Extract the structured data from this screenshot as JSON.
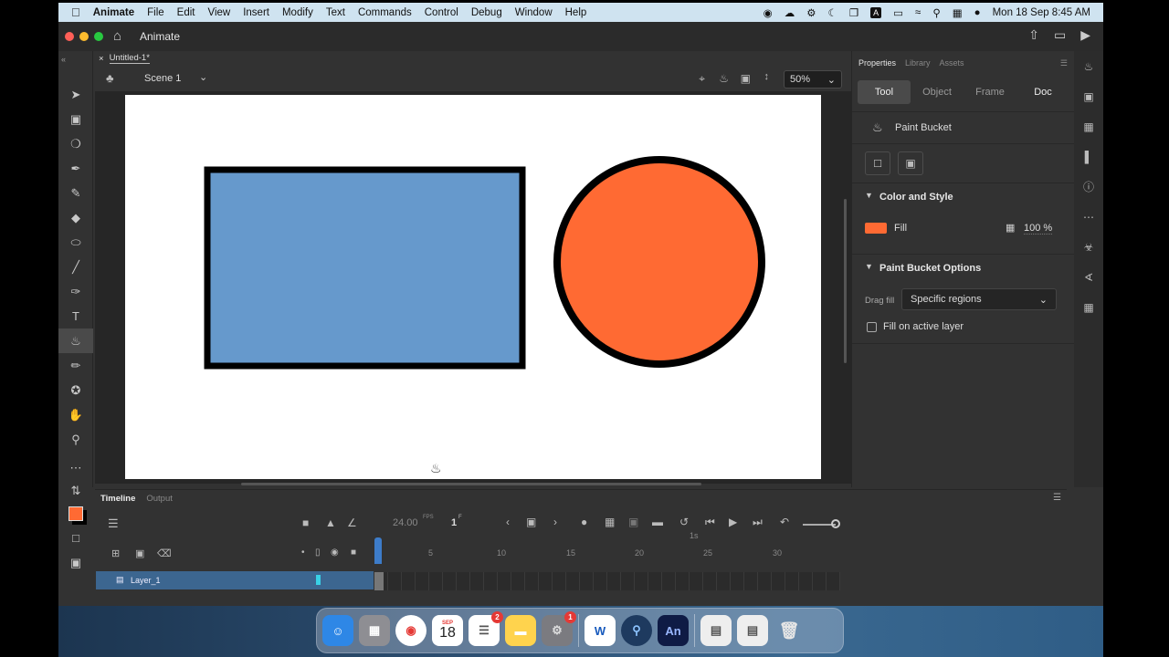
{
  "menubar": {
    "app": "Animate",
    "items": [
      "File",
      "Edit",
      "View",
      "Insert",
      "Modify",
      "Text",
      "Commands",
      "Control",
      "Debug",
      "Window",
      "Help"
    ],
    "clock": "Mon 18 Sep  8:45 AM",
    "status_a_letter": "A"
  },
  "window": {
    "title": "Animate",
    "doc_tab": "Untitled-1*",
    "scene": "Scene 1",
    "zoom": "50%"
  },
  "stage": {
    "rect": {
      "fill": "#6699cc",
      "stroke": "#000000"
    },
    "circle": {
      "fill": "#ff6a33",
      "stroke": "#000000"
    }
  },
  "properties": {
    "tabs": [
      "Properties",
      "Library",
      "Assets"
    ],
    "subtabs": [
      "Tool",
      "Object",
      "Frame",
      "Doc"
    ],
    "tool_name": "Paint Bucket",
    "color_style_header": "Color and Style",
    "fill_label": "Fill",
    "fill_color": "#ff6a33",
    "fill_opacity": "100 %",
    "bucket_header": "Paint Bucket Options",
    "drag_fill_label": "Drag fill",
    "drag_fill_value": "Specific regions",
    "fill_active_label": "Fill on active layer"
  },
  "timeline": {
    "tabs": [
      "Timeline",
      "Output"
    ],
    "fps": "24.00",
    "fps_unit": "FPS",
    "frame": "1",
    "frame_unit": "F",
    "marker": "1s",
    "frame_numbers": [
      "5",
      "10",
      "15",
      "20",
      "25",
      "30"
    ],
    "layer_name": "Layer_1"
  },
  "colors": {
    "stroke_swatch": "#000000",
    "fill_swatch": "#ff6a33",
    "layer_selected": "#3c6690",
    "playhead": "#3d7cc9"
  },
  "dock": {
    "calendar_month": "SEP",
    "calendar_day": "18",
    "reminders_badge": "2",
    "settings_badge": "1",
    "word_letter": "W",
    "animate_letters": "An"
  }
}
